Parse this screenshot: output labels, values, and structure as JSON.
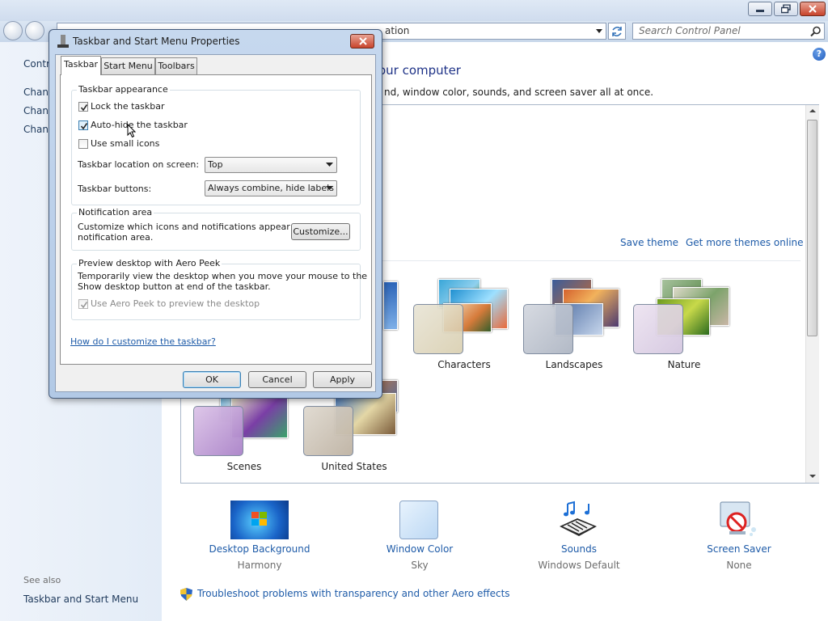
{
  "window": {
    "address_text": "ation",
    "search_placeholder": "Search Control Panel"
  },
  "left_pane": {
    "items": [
      {
        "label": "Contr"
      },
      {
        "label": "Chang"
      },
      {
        "label": "Chang"
      },
      {
        "label": "Chang"
      }
    ],
    "see_also": "See also",
    "see_also_link": "Taskbar and Start Menu"
  },
  "main": {
    "heading": "our computer",
    "subtext": "nd, window color, sounds, and screen saver all at once.",
    "save_theme": "Save theme",
    "get_more_themes": "Get more themes online",
    "themes": [
      {
        "label": "Characters"
      },
      {
        "label": "Landscapes"
      },
      {
        "label": "Nature"
      },
      {
        "label": "Scenes"
      },
      {
        "label": "United States"
      }
    ],
    "tools": [
      {
        "label": "Desktop Background",
        "value": "Harmony"
      },
      {
        "label": "Window Color",
        "value": "Sky"
      },
      {
        "label": "Sounds",
        "value": "Windows Default"
      },
      {
        "label": "Screen Saver",
        "value": "None"
      }
    ],
    "troubleshoot": "Troubleshoot problems with transparency and other Aero effects"
  },
  "dialog": {
    "title": "Taskbar and Start Menu Properties",
    "tabs": [
      "Taskbar",
      "Start Menu",
      "Toolbars"
    ],
    "appearance": {
      "title": "Taskbar appearance",
      "lock": {
        "label": "Lock the taskbar",
        "checked": true
      },
      "autohide": {
        "label": "Auto-hide the taskbar",
        "checked": true
      },
      "small_icons": {
        "label": "Use small icons",
        "checked": false
      },
      "location_label": "Taskbar location on screen:",
      "location_value": "Top",
      "buttons_label": "Taskbar buttons:",
      "buttons_value": "Always combine, hide labels"
    },
    "notification": {
      "title": "Notification area",
      "text1": "Customize which icons and notifications appear in the",
      "text2": "notification area.",
      "customize": "Customize..."
    },
    "peek": {
      "title": "Preview desktop with Aero Peek",
      "text1": "Temporarily view the desktop when you move your mouse to the",
      "text2": "Show desktop button at end of the taskbar.",
      "checkbox": "Use Aero Peek to preview the desktop"
    },
    "help_link": "How do I customize the taskbar?",
    "ok": "OK",
    "cancel": "Cancel",
    "apply": "Apply"
  },
  "colors": {
    "link": "#1e5ba8",
    "heading": "#1e3287",
    "dialog_frame": "#b2c9e6"
  }
}
